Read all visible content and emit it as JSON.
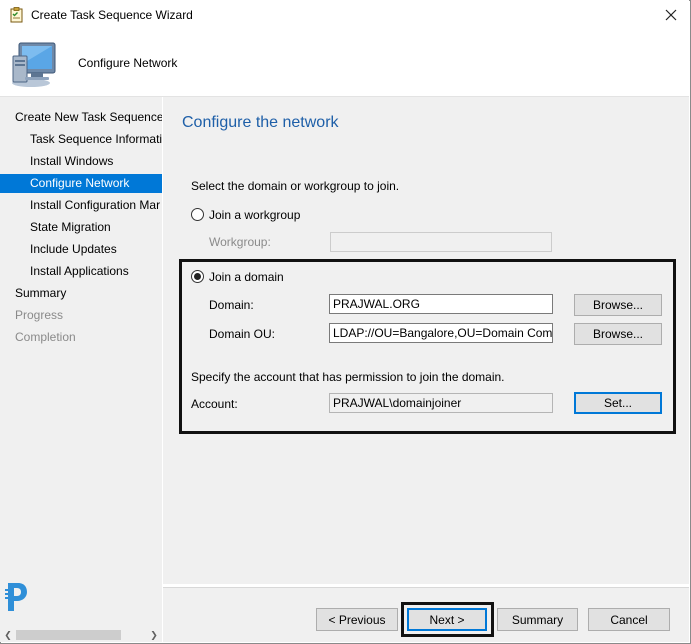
{
  "window": {
    "title": "Create Task Sequence Wizard"
  },
  "header": {
    "title": "Configure Network"
  },
  "nav": {
    "items": [
      {
        "label": "Create New Task Sequence"
      },
      {
        "label": "Task Sequence Informatio"
      },
      {
        "label": "Install Windows"
      },
      {
        "label": "Configure Network"
      },
      {
        "label": "Install Configuration Mar"
      },
      {
        "label": "State Migration"
      },
      {
        "label": "Include Updates"
      },
      {
        "label": "Install Applications"
      },
      {
        "label": "Summary"
      },
      {
        "label": "Progress"
      },
      {
        "label": "Completion"
      }
    ]
  },
  "page": {
    "heading": "Configure the network",
    "instruction": "Select the domain or workgroup to join.",
    "workgroup_radio_label": "Join a workgroup",
    "workgroup_label": "Workgroup:",
    "workgroup_value": "",
    "domain_radio_label": "Join a domain",
    "domain_label": "Domain:",
    "domain_value": "PRAJWAL.ORG",
    "domain_browse": "Browse...",
    "domain_ou_label": "Domain OU:",
    "domain_ou_value": "LDAP://OU=Bangalore,OU=Domain Comps,D",
    "domain_ou_browse": "Browse...",
    "account_instruction": "Specify the account that has permission to join the domain.",
    "account_label": "Account:",
    "account_value": "PRAJWAL\\domainjoiner",
    "account_set": "Set...",
    "selected_option": "Join a domain"
  },
  "footer": {
    "previous": "< Previous",
    "next": "Next >",
    "summary": "Summary",
    "cancel": "Cancel"
  },
  "icons": {
    "title": "wizard-checklist-icon",
    "header": "computer-monitor-icon",
    "watermark": "logo-icon"
  },
  "colors": {
    "selection": "#0078d7",
    "heading": "#1e5fa8",
    "panel": "#f0f0f0"
  }
}
